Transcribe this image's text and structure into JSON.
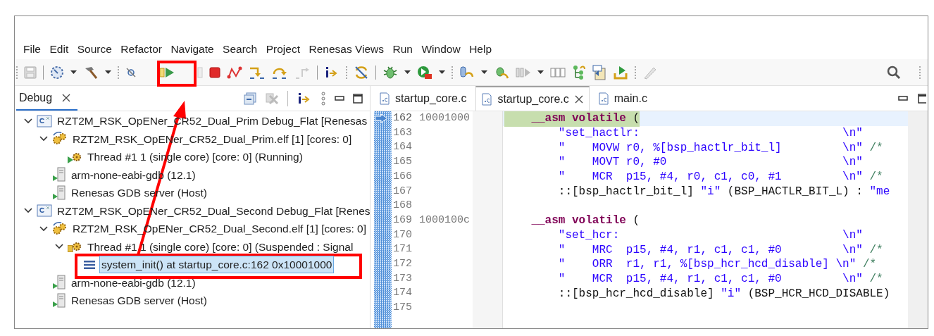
{
  "menu": [
    "File",
    "Edit",
    "Source",
    "Refactor",
    "Navigate",
    "Search",
    "Project",
    "Renesas Views",
    "Run",
    "Window",
    "Help"
  ],
  "debug_view": {
    "tab": {
      "label": "Debug",
      "selected": true
    },
    "tree": [
      {
        "kind": "launch",
        "label": "RZT2M_RSK_OpENer_CR52_Dual_Prim Debug_Flat [Renesas",
        "expanded": true,
        "selected": false,
        "children": [
          {
            "kind": "process",
            "label": "RZT2M_RSK_OpENer_CR52_Dual_Prim.elf [1] [cores: 0]",
            "expanded": true,
            "selected": false,
            "children": [
              {
                "kind": "thread",
                "label": "Thread #1 1 (single core) [core: 0] (Running)",
                "running": true,
                "selected": false
              }
            ]
          },
          {
            "kind": "gdb",
            "label": "arm-none-eabi-gdb (12.1)",
            "selected": false
          },
          {
            "kind": "gdb",
            "label": "Renesas GDB server (Host)",
            "selected": false
          }
        ]
      },
      {
        "kind": "launch",
        "label": "RZT2M_RSK_OpENer_CR52_Dual_Second Debug_Flat [Renes",
        "expanded": true,
        "selected": false,
        "children": [
          {
            "kind": "process",
            "label": "RZT2M_RSK_OpENer_CR52_Dual_Second.elf [1] [cores: 0]",
            "expanded": true,
            "selected": false,
            "children": [
              {
                "kind": "thread",
                "label": "Thread #1 1 (single core) [core: 0] (Suspended : Signal",
                "running": false,
                "expanded": true,
                "selected": false,
                "children": [
                  {
                    "kind": "frame",
                    "label": "system_init() at startup_core.c:162 0x10001000",
                    "selected": true
                  }
                ]
              }
            ]
          },
          {
            "kind": "gdb",
            "label": "arm-none-eabi-gdb (12.1)",
            "selected": false
          },
          {
            "kind": "gdb",
            "label": "Renesas GDB server (Host)",
            "selected": false
          }
        ]
      }
    ]
  },
  "editor": {
    "tabs": [
      {
        "label": "startup_core.c",
        "selected": false
      },
      {
        "label": "startup_core.c",
        "selected": true
      },
      {
        "label": "main.c",
        "selected": false
      }
    ],
    "lines": [
      {
        "number": "162",
        "address": "10001000",
        "current": true,
        "segments": [
          {
            "kind": "keyword",
            "text": "    __asm volatile"
          },
          {
            "kind": "plain",
            "text": " ("
          }
        ]
      },
      {
        "number": "163",
        "current": false,
        "segments": [
          {
            "kind": "string",
            "text": "        \"set_hactlr:                              \\n\""
          }
        ]
      },
      {
        "number": "164",
        "current": false,
        "segments": [
          {
            "kind": "string",
            "text": "        \"    MOVW r0, %[bsp_hactlr_bit_l]         \\n\""
          },
          {
            "kind": "comment",
            "text": " /*"
          }
        ]
      },
      {
        "number": "165",
        "current": false,
        "segments": [
          {
            "kind": "string",
            "text": "        \"    MOVT r0, #0                          \\n\""
          }
        ]
      },
      {
        "number": "166",
        "current": false,
        "segments": [
          {
            "kind": "string",
            "text": "        \"    MCR  p15, #4, r0, c1, c0, #1         \\n\""
          },
          {
            "kind": "comment",
            "text": " /*"
          }
        ]
      },
      {
        "number": "167",
        "current": false,
        "segments": [
          {
            "kind": "plain",
            "text": "        ::[bsp_hactlr_bit_l] "
          },
          {
            "kind": "string",
            "text": "\"i\""
          },
          {
            "kind": "plain",
            "text": " (BSP_HACTLR_BIT_L) : "
          },
          {
            "kind": "string",
            "text": "\"me"
          }
        ]
      },
      {
        "number": "168",
        "current": false
      },
      {
        "number": "169",
        "address": "1000100c",
        "current": false,
        "segments": [
          {
            "kind": "keyword",
            "text": "    __asm volatile"
          },
          {
            "kind": "plain",
            "text": " ("
          }
        ]
      },
      {
        "number": "170",
        "current": false,
        "segments": [
          {
            "kind": "string",
            "text": "        \"set_hcr:                                 \\n\""
          }
        ]
      },
      {
        "number": "171",
        "current": false,
        "segments": [
          {
            "kind": "string",
            "text": "        \"    MRC  p15, #4, r1, c1, c1, #0         \\n\""
          },
          {
            "kind": "comment",
            "text": " /*"
          }
        ]
      },
      {
        "number": "172",
        "current": false,
        "segments": [
          {
            "kind": "string",
            "text": "        \"    ORR  r1, r1, %[bsp_hcr_hcd_disable] \\n\""
          },
          {
            "kind": "comment",
            "text": " /*"
          }
        ]
      },
      {
        "number": "173",
        "current": false,
        "segments": [
          {
            "kind": "string",
            "text": "        \"    MCR  p15, #4, r1, c1, c1, #0         \\n\""
          },
          {
            "kind": "comment",
            "text": " /*"
          }
        ]
      },
      {
        "number": "174",
        "current": false,
        "segments": [
          {
            "kind": "plain",
            "text": "        ::[bsp_hcr_hcd_disable] "
          },
          {
            "kind": "string",
            "text": "\"i\""
          },
          {
            "kind": "plain",
            "text": " (BSP_HCR_HCD_DISABLE)"
          }
        ]
      },
      {
        "number": "175",
        "current": false
      }
    ]
  }
}
